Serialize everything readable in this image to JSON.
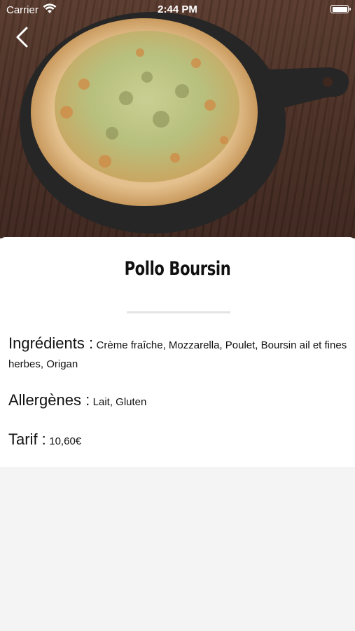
{
  "status_bar": {
    "carrier": "Carrier",
    "time": "2:44 PM"
  },
  "product": {
    "name": "Pollo Boursin",
    "ingredients_label": "Ingrédients :",
    "ingredients": "Crème fraîche, Mozzarella, Poulet, Boursin ail et fines herbes, Origan",
    "allergens_label": "Allergènes :",
    "allergens": "Lait, Gluten",
    "price_label": "Tarif :",
    "price": "10,60€"
  },
  "icons": {
    "back": "chevron-left-icon",
    "wifi": "wifi-icon",
    "battery": "battery-icon"
  }
}
